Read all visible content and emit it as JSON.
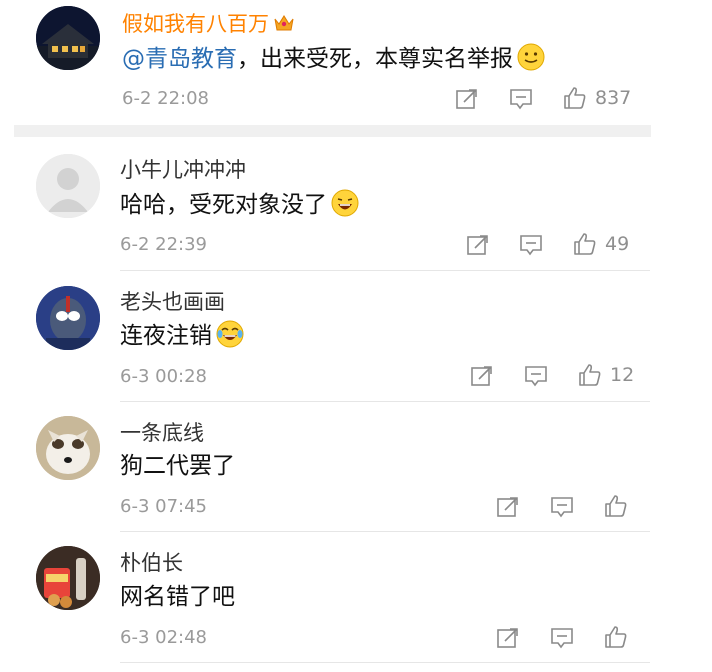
{
  "comments": [
    {
      "username": "假如我有八百万",
      "mention": "@青岛教育",
      "text": "，出来受死，本尊实名举报",
      "time": "6-2 22:08",
      "likes": "837",
      "emoji": "smile-emoji",
      "badge": "crown-icon"
    },
    {
      "username": "小牛儿冲冲冲",
      "text": "哈哈，受死对象没了",
      "time": "6-2 22:39",
      "likes": "49",
      "emoji": "laugh-emoji"
    },
    {
      "username": "老头也画画",
      "text": "连夜注销",
      "time": "6-3 00:28",
      "likes": "12",
      "emoji": "tears-of-joy-emoji"
    },
    {
      "username": "一条底线",
      "text": "狗二代罢了",
      "time": "6-3 07:45",
      "likes": ""
    },
    {
      "username": "朴伯长",
      "text": "网名错了吧",
      "time": "6-3 02:48",
      "likes": ""
    }
  ],
  "colors": {
    "vip_name": "#ff8200",
    "mention": "#2a6db3",
    "meta": "#9a9a9a"
  }
}
